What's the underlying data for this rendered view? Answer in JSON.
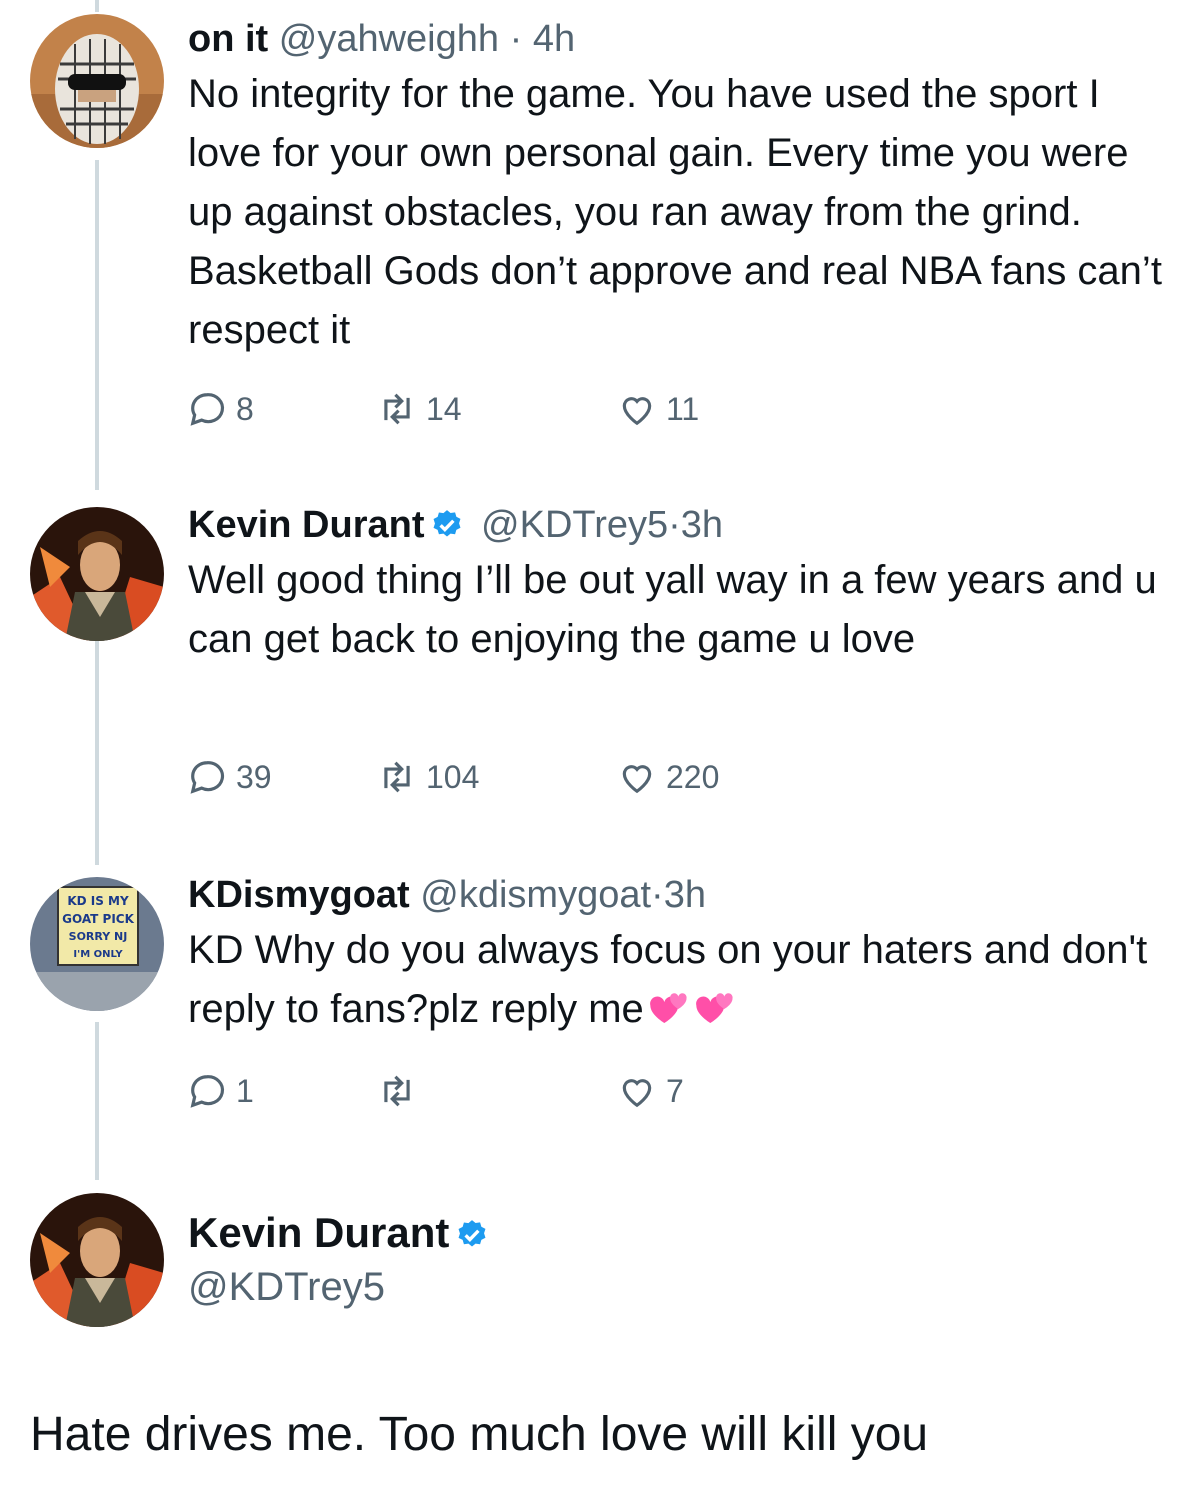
{
  "colors": {
    "verified": "#1d9bf0",
    "secondary": "#536471",
    "text": "#0f1419",
    "heart_pink": "#ff4fa8"
  },
  "tweets": [
    {
      "name": "on it",
      "handle": "@yahweighh",
      "dot": "·",
      "time": "4h",
      "verified": false,
      "text": "No integrity for the game. You have used the sport I love for your own personal gain. Every time you were up against obstacles, you ran away from the grind. Basketball Gods don’t approve and real NBA fans can’t respect it",
      "replies": "8",
      "retweets": "14",
      "likes": "11",
      "avatar_icon": "keffiyeh-avatar"
    },
    {
      "name": "Kevin Durant",
      "handle": "@KDTrey5",
      "dot": "·",
      "time": "3h",
      "verified": true,
      "text": "Well good thing I’ll be out yall way in a few years and u can get back to enjoying the game u love",
      "replies": "39",
      "retweets": "104",
      "likes": "220",
      "avatar_icon": "animated-character-avatar"
    },
    {
      "name": "KDismygoat",
      "handle": "@kdismygoat",
      "dot": "·",
      "time": "3h",
      "verified": false,
      "text": "KD Why do you always focus on your haters and don't reply to fans?plz reply me",
      "replies": "1",
      "retweets": "",
      "likes": "7",
      "avatar_icon": "fan-sign-avatar",
      "avatar_sign": [
        "KD IS MY",
        "GOAT PICK",
        "SORRY NJ",
        "I'M ONLY"
      ],
      "emoji": [
        "two-hearts",
        "two-hearts"
      ]
    }
  ],
  "main_tweet": {
    "name": "Kevin Durant",
    "handle": "@KDTrey5",
    "verified": true,
    "text": "Hate drives me. Too much love will kill you",
    "avatar_icon": "animated-character-avatar"
  }
}
